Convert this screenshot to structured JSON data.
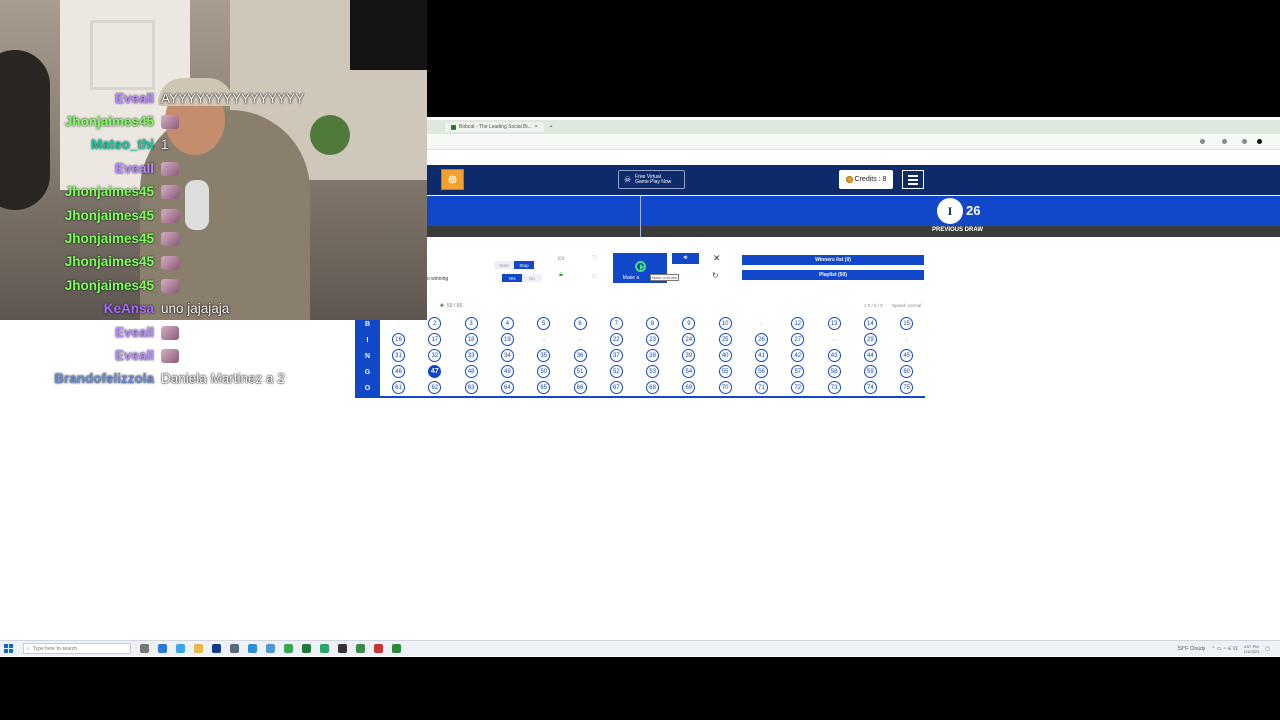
{
  "browser": {
    "tab_title": "Bobcat - The Leading Social Bi...",
    "tab_close": "×",
    "new_tab": "+"
  },
  "site": {
    "virtual_games_label": "Free Virtual Game Play Now",
    "credits_label": "Credits : 8",
    "draw": {
      "letter": "I",
      "number": "26",
      "previous_draw_label": "PREVIOUS DRAW"
    },
    "controls": {
      "start_left": "Start",
      "start_right": "Stop",
      "auto_yes": "Yes",
      "auto_no": "No",
      "autowin_label": "o winning",
      "make_button_label": "Make a",
      "tooltip": "Make a stroke",
      "winners_list": "Winners list (0)",
      "playlist": "Playlist (50)",
      "players": "50 / 50",
      "right_info": "1 0 / 0 / 0",
      "speed_info": "Speed: normal"
    }
  },
  "board": {
    "rows": [
      {
        "letter": "B",
        "start": 1
      },
      {
        "letter": "I",
        "start": 16
      },
      {
        "letter": "N",
        "start": 31
      },
      {
        "letter": "G",
        "start": 46
      },
      {
        "letter": "O",
        "start": 61
      }
    ],
    "faded": [
      1,
      11,
      20,
      21,
      28,
      30
    ],
    "current": 47
  },
  "chat": [
    {
      "user": "Eveall",
      "color": "#b889ff",
      "text": "AYYYYYYYYYYYYYYY"
    },
    {
      "user": "Jhonjaimes45",
      "color": "#7aff5a",
      "text": "",
      "emote": true
    },
    {
      "user": "Mateo_thi",
      "color": "#12c9a0",
      "text": "1"
    },
    {
      "user": "Eveall",
      "color": "#b889ff",
      "text": "",
      "emote": true
    },
    {
      "user": "Jhonjaimes45",
      "color": "#7aff5a",
      "text": "",
      "emote": true
    },
    {
      "user": "Jhonjaimes45",
      "color": "#7aff5a",
      "text": "",
      "emote": true
    },
    {
      "user": "Jhonjaimes45",
      "color": "#7aff5a",
      "text": "",
      "emote": true
    },
    {
      "user": "Jhonjaimes45",
      "color": "#7aff5a",
      "text": "",
      "emote": true
    },
    {
      "user": "Jhonjaimes45",
      "color": "#7aff5a",
      "text": "",
      "emote": true
    },
    {
      "user": "KeAnsa",
      "color": "#a66cff",
      "text": "uno jajajaja"
    },
    {
      "user": "Eveall",
      "color": "#b889ff",
      "text": "",
      "emote": true
    },
    {
      "user": "Eveall",
      "color": "#b889ff",
      "text": "",
      "emote": true
    },
    {
      "user": "Brandofelizzola",
      "color": "#6a8ccf",
      "text": "Daniela Martinez a 2"
    }
  ],
  "taskbar": {
    "search_placeholder": "Type here to search",
    "weather": "59°F  Cloudy",
    "time": "4:57 PM",
    "date": "1/1/2023"
  }
}
